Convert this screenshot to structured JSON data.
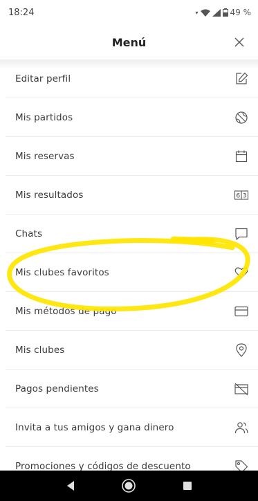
{
  "status_bar": {
    "time": "18:24",
    "battery": "49 %"
  },
  "header": {
    "title": "Menú"
  },
  "menu": [
    {
      "label": "Editar perfil",
      "icon": "edit-icon"
    },
    {
      "label": "Mis partidos",
      "icon": "tennis-ball-icon"
    },
    {
      "label": "Mis reservas",
      "icon": "calendar-icon"
    },
    {
      "label": "Mis resultados",
      "icon": "scoreboard-icon",
      "score_left": "6",
      "score_right": "3"
    },
    {
      "label": "Chats",
      "icon": "chat-icon"
    },
    {
      "label": "Mis clubes favoritos",
      "icon": "heart-icon"
    },
    {
      "label": "Mis métodos de pago",
      "icon": "credit-card-icon"
    },
    {
      "label": "Mis clubes",
      "icon": "location-pin-icon"
    },
    {
      "label": "Pagos pendientes",
      "icon": "card-off-icon"
    },
    {
      "label": "Invita a tus amigos y gana dinero",
      "icon": "invite-friends-icon"
    },
    {
      "label": "Promociones y códigos de descuento",
      "icon": "tag-icon"
    }
  ],
  "colors": {
    "highlight": "#ffe500",
    "nav_bar": "#000000"
  }
}
